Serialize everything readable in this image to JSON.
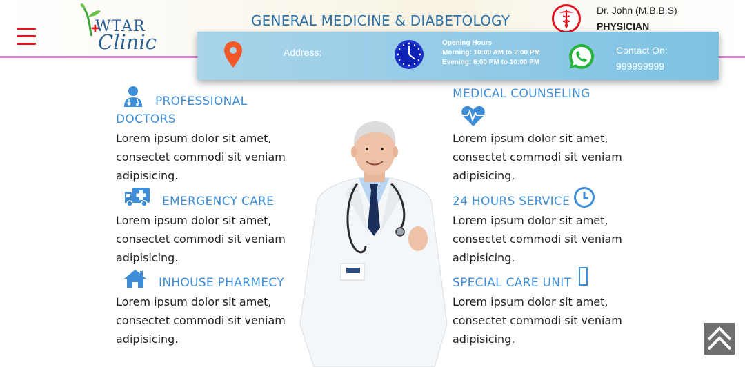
{
  "header": {
    "logo_word1": "WTAR",
    "logo_word2": "Clinic",
    "title": "GENERAL MEDICINE & DIABETOLOGY",
    "doctor_name": "Dr. John (M.B.B.S)",
    "doctor_title": "PHYSICIAN",
    "menu_icon": "hamburger-menu-icon",
    "emblem_icon": "caduceus-emblem-icon"
  },
  "info_bar": {
    "address_label": "Address:",
    "hours_title": "Opening Hours",
    "hours_morning": "Morning: 10:00 AM to 2:00 PM",
    "hours_evening": "Evening: 6:00 PM to 10:00 PM",
    "contact_label": "Contact On:",
    "contact_number": "999999999",
    "icons": [
      "location-pin-icon",
      "clock-icon",
      "whatsapp-icon"
    ]
  },
  "services": {
    "left": [
      {
        "title": "PROFESSIONAL DOCTORS",
        "text": "Lorem ipsum dolor sit amet, consectet commodi sit veniam adipisicing.",
        "icon": "doctor-icon"
      },
      {
        "title": "EMERGENCY CARE",
        "text": "Lorem ipsum dolor sit amet, consectet commodi sit veniam adipisicing.",
        "icon": "ambulance-icon"
      },
      {
        "title": "INHOUSE PHARMECY",
        "text": "Lorem ipsum dolor sit amet, consectet commodi sit veniam adipisicing.",
        "icon": "home-icon"
      }
    ],
    "right": [
      {
        "title": "MEDICAL COUNSELING",
        "text": "Lorem ipsum dolor sit amet, consectet commodi sit veniam adipisicing.",
        "icon": "heartbeat-icon"
      },
      {
        "title": "24 HOURS SERVICE",
        "text": "Lorem ipsum dolor sit amet, consectet commodi sit veniam adipisicing.",
        "icon": "clock-icon"
      },
      {
        "title": "SPECIAL CARE UNIT",
        "text": "Lorem ipsum dolor sit amet, consectet commodi sit veniam adipisicing.",
        "icon": "missing-glyph-icon"
      }
    ]
  },
  "colors": {
    "accent_blue": "#3d8ed6",
    "title_blue": "#2f72a8",
    "menu_red": "#e0141e",
    "header_border": "#d985d4",
    "info_bar": "#7ec2e2",
    "pin_orange": "#f0582a",
    "whatsapp_green": "#25b33c",
    "scroll_button": "#6f6f6f"
  }
}
